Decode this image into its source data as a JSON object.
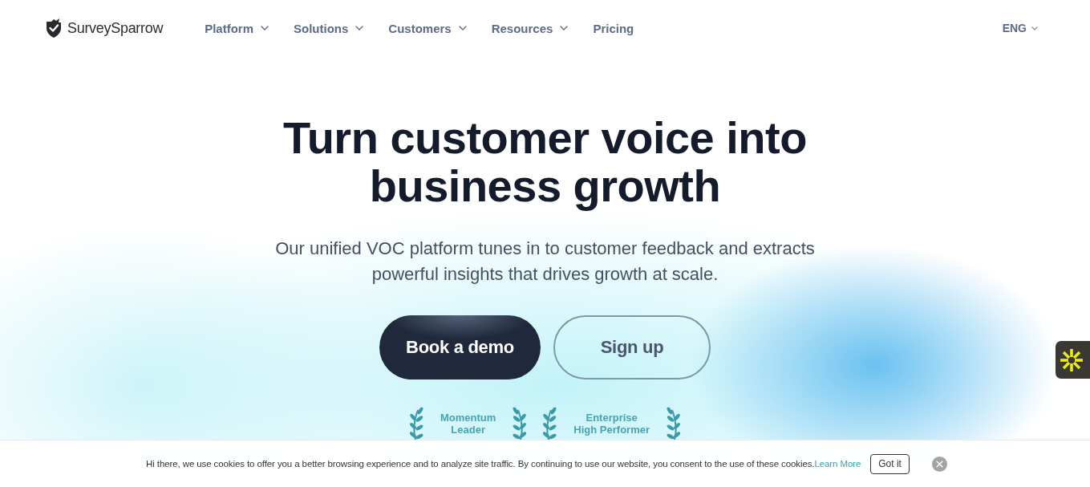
{
  "header": {
    "logo": {
      "text": "SurveySparrow"
    },
    "nav": [
      {
        "label": "Platform",
        "dropdown": true
      },
      {
        "label": "Solutions",
        "dropdown": true
      },
      {
        "label": "Customers",
        "dropdown": true
      },
      {
        "label": "Resources",
        "dropdown": true
      },
      {
        "label": "Pricing",
        "dropdown": false
      }
    ],
    "language": {
      "label": "ENG",
      "dropdown": true
    }
  },
  "hero": {
    "headline": "Turn customer voice into business growth",
    "subtitle": "Our unified VOC platform tunes in to customer feedback and extracts powerful insights that drives growth at scale.",
    "buttons": [
      {
        "label": "Book a demo",
        "kind": "primary"
      },
      {
        "label": "Sign up",
        "kind": "secondary"
      }
    ],
    "awards": [
      {
        "title": "Momentum\nLeader"
      },
      {
        "title": "Enterprise\nHigh Performer"
      }
    ]
  },
  "cookie_banner": {
    "message": "Hi there, we use cookies to offer you a better browsing experience and to analyze site traffic. By continuing to use our website, you consent to the use of these cookies.",
    "link": "Learn More",
    "button": "Got it"
  }
}
